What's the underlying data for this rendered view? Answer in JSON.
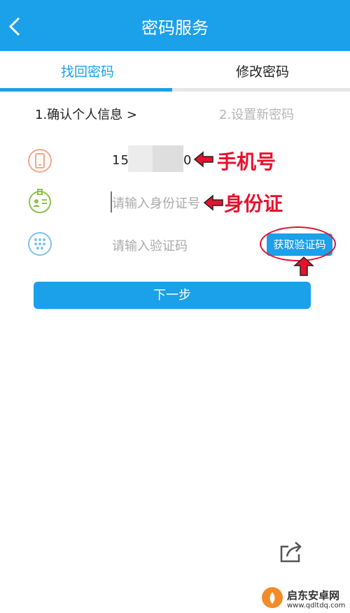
{
  "header": {
    "title": "密码服务",
    "back_icon": "chevron-left-icon"
  },
  "tabs": [
    {
      "label": "找回密码",
      "active": true
    },
    {
      "label": "修改密码",
      "active": false
    }
  ],
  "steps": {
    "step1": "1.确认个人信息 >",
    "step2": "2.设置新密码"
  },
  "form": {
    "phone_value_prefix": "15",
    "phone_value_suffix": "0",
    "id_placeholder": "请输入身份证号",
    "code_placeholder": "请输入验证码",
    "get_code_label": "获取验证码",
    "next_label": "下一步"
  },
  "annotations": {
    "phone": "手机号",
    "id": "身份证"
  },
  "watermark": {
    "name": "启东安卓网",
    "url": "www.qdltdq.com"
  },
  "colors": {
    "accent": "#1ba0ea",
    "annotation": "#e8112d"
  }
}
